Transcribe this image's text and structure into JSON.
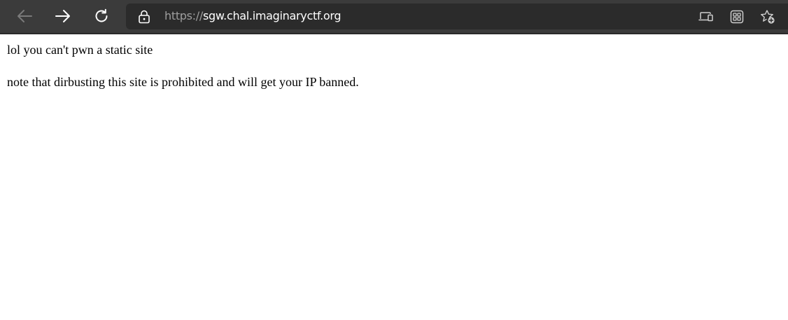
{
  "browser": {
    "url_scheme": "https://",
    "url_host": "sgw.chal.imaginaryctf.org",
    "icons": {
      "back": "back-arrow-icon",
      "forward": "forward-arrow-icon",
      "refresh": "refresh-icon",
      "lock": "lock-icon",
      "devices": "devices-icon",
      "extensions": "extensions-icon",
      "favorite": "add-favorite-icon"
    }
  },
  "page": {
    "line1": "lol you can't pwn a static site",
    "line2": "note that dirbusting this site is prohibited and will get your IP banned."
  },
  "colors": {
    "toolbar_bg": "#3b3b3b",
    "address_bar_bg": "#2b2b2b",
    "url_scheme": "#9e9e9e",
    "url_host": "#ffffff",
    "page_bg": "#ffffff",
    "page_text": "#000000"
  }
}
